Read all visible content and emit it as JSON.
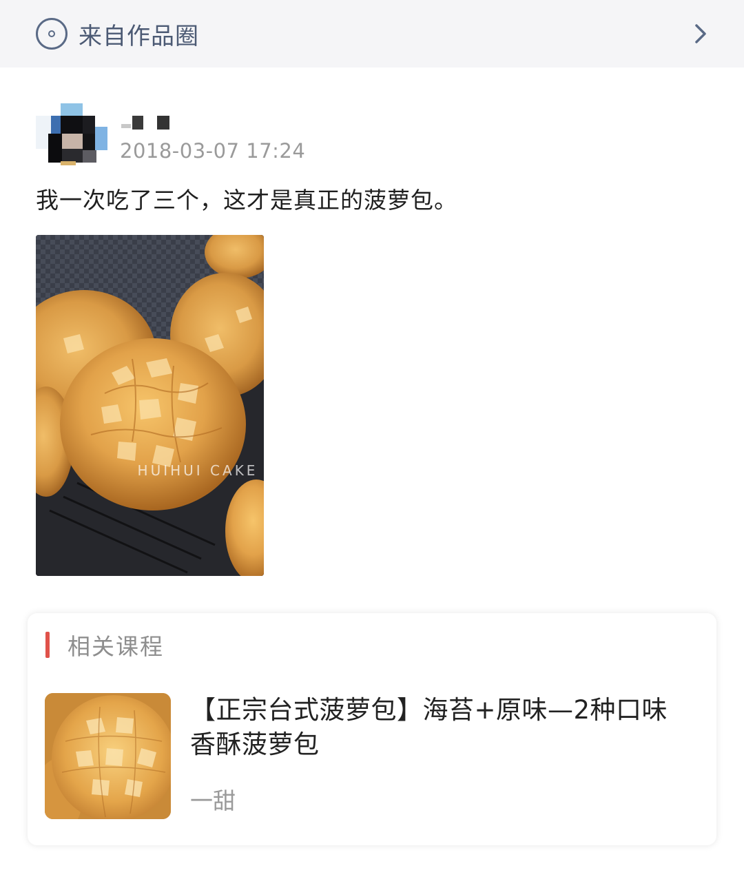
{
  "header": {
    "icon": "circle-dot-icon",
    "title": "来自作品圈",
    "chevron_icon": "chevron-right-icon"
  },
  "post": {
    "author": {
      "avatar": "pixelated-avatar",
      "name": ""
    },
    "time": "2018-03-07 17:24",
    "text": "我一次吃了三个，这才是真正的菠萝包。",
    "image": {
      "watermark": "HUIHUI CAKE"
    }
  },
  "related": {
    "section_label": "相关课程",
    "accent_color": "#e0524a",
    "course": {
      "title": "【正宗台式菠萝包】海苔+原味—2种口味香酥菠萝包",
      "author": "一甜"
    }
  }
}
